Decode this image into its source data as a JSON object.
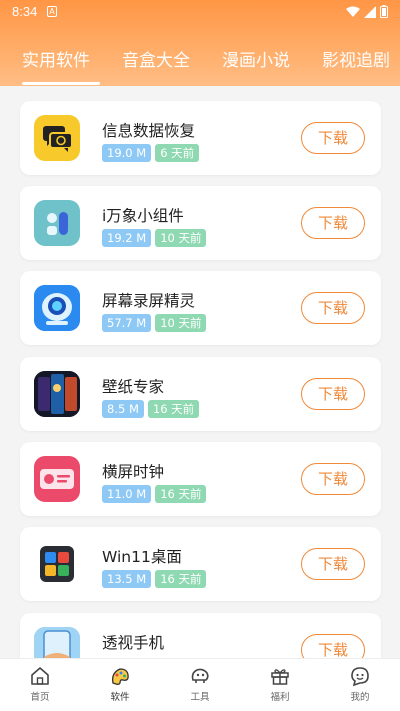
{
  "status": {
    "time": "8:34",
    "notif": "A"
  },
  "tabs": [
    {
      "label": "实用软件"
    },
    {
      "label": "音盒大全"
    },
    {
      "label": "漫画小说"
    },
    {
      "label": "影视追剧"
    }
  ],
  "apps": [
    {
      "name": "信息数据恢复",
      "size": "19.0 M",
      "time": "6 天前",
      "icon": "message-recovery-icon",
      "button": "下载"
    },
    {
      "name": "i万象小组件",
      "size": "19.2 M",
      "time": "10 天前",
      "icon": "widget-icon",
      "button": "下载"
    },
    {
      "name": "屏幕录屏精灵",
      "size": "57.7 M",
      "time": "10 天前",
      "icon": "screen-recorder-icon",
      "button": "下载"
    },
    {
      "name": "壁纸专家",
      "size": "8.5 M",
      "time": "16 天前",
      "icon": "wallpaper-icon",
      "button": "下载"
    },
    {
      "name": "横屏时钟",
      "size": "11.0 M",
      "time": "16 天前",
      "icon": "clock-icon",
      "button": "下载"
    },
    {
      "name": "Win11桌面",
      "size": "13.5 M",
      "time": "16 天前",
      "icon": "win11-icon",
      "button": "下载"
    },
    {
      "name": "透视手机",
      "size": "",
      "time": "",
      "icon": "see-through-phone-icon",
      "button": "下载"
    }
  ],
  "nav": [
    {
      "label": "首页",
      "icon": "home-icon"
    },
    {
      "label": "软件",
      "icon": "software-icon"
    },
    {
      "label": "工具",
      "icon": "tools-icon"
    },
    {
      "label": "福利",
      "icon": "gift-icon"
    },
    {
      "label": "我的",
      "icon": "profile-icon"
    }
  ],
  "colors": {
    "accent": "#f08a3b",
    "header": "#ff9645",
    "size_badge": "#8ec9f5",
    "time_badge": "#8ed8b2"
  }
}
